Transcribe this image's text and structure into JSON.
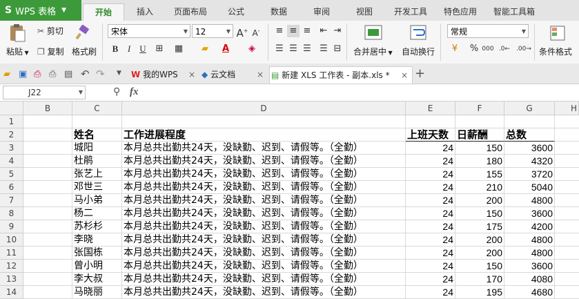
{
  "app": {
    "logo": "S",
    "name": "WPS 表格"
  },
  "menu_tabs": [
    "开始",
    "插入",
    "页面布局",
    "公式",
    "数据",
    "审阅",
    "视图",
    "开发工具",
    "特色应用",
    "智能工具箱"
  ],
  "ribbon": {
    "paste": "粘贴",
    "cut": "剪切",
    "copy": "复制",
    "format_painter": "格式刷",
    "font_name": "宋体",
    "font_size": "12",
    "bold": "B",
    "italic": "I",
    "underline": "U",
    "merge_center": "合并居中",
    "wrap_text": "自动换行",
    "number_format": "常规",
    "percent": "%",
    "thousands": "000",
    "conditional_format": "条件格式"
  },
  "doc_tabs": [
    {
      "label": "我的WPS",
      "close": "×"
    },
    {
      "label": "云文档",
      "close": "×"
    },
    {
      "label": "新建 XLS 工作表 - 副本.xls *",
      "close": "×"
    }
  ],
  "new_tab": "+",
  "formula_bar": {
    "cell_ref": "J22",
    "fx": "fx",
    "value": ""
  },
  "columns": [
    "B",
    "C",
    "D",
    "E",
    "F",
    "G",
    "H"
  ],
  "header_row": {
    "name": "姓名",
    "progress": "工作进展程度",
    "days": "上班天数",
    "wage": "日薪酬",
    "total": "总数"
  },
  "rows": [
    {
      "num": "3",
      "name": "城阳",
      "progress": "本月总共出勤共24天，没缺勤、迟到、请假等。（全勤）",
      "days": "24",
      "wage": "150",
      "total": "3600"
    },
    {
      "num": "4",
      "name": "杜鹃",
      "progress": "本月总共出勤共24天，没缺勤、迟到、请假等。（全勤）",
      "days": "24",
      "wage": "180",
      "total": "4320"
    },
    {
      "num": "5",
      "name": "张艺上",
      "progress": "本月总共出勤共24天，没缺勤、迟到、请假等。（全勤）",
      "days": "24",
      "wage": "155",
      "total": "3720"
    },
    {
      "num": "6",
      "name": "邓世三",
      "progress": "本月总共出勤共24天，没缺勤、迟到、请假等。（全勤）",
      "days": "24",
      "wage": "210",
      "total": "5040"
    },
    {
      "num": "7",
      "name": "马小弟",
      "progress": "本月总共出勤共24天，没缺勤、迟到、请假等。（全勤）",
      "days": "24",
      "wage": "200",
      "total": "4800"
    },
    {
      "num": "8",
      "name": "杨二",
      "progress": "本月总共出勤共24天，没缺勤、迟到、请假等。（全勤）",
      "days": "24",
      "wage": "150",
      "total": "3600"
    },
    {
      "num": "9",
      "name": "苏杉杉",
      "progress": "本月总共出勤共24天，没缺勤、迟到、请假等。（全勤）",
      "days": "24",
      "wage": "175",
      "total": "4200"
    },
    {
      "num": "10",
      "name": "李晓",
      "progress": "本月总共出勤共24天，没缺勤、迟到、请假等。（全勤）",
      "days": "24",
      "wage": "200",
      "total": "4800"
    },
    {
      "num": "11",
      "name": "张国栋",
      "progress": "本月总共出勤共24天，没缺勤、迟到、请假等。（全勤）",
      "days": "24",
      "wage": "200",
      "total": "4800"
    },
    {
      "num": "12",
      "name": "曾小明",
      "progress": "本月总共出勤共24天，没缺勤、迟到、请假等。（全勤）",
      "days": "24",
      "wage": "150",
      "total": "3600"
    },
    {
      "num": "13",
      "name": "李大叔",
      "progress": "本月总共出勤共24天，没缺勤、迟到、请假等。（全勤）",
      "days": "24",
      "wage": "170",
      "total": "4080"
    },
    {
      "num": "14",
      "name": "马晓丽",
      "progress": "本月总共出勤共24天，没缺勤、迟到、请假等。（全勤）",
      "days": "24",
      "wage": "195",
      "total": "4680"
    }
  ],
  "colors": {
    "brand": "#3d9a3a",
    "active_tab_text": "#2f8a2a"
  }
}
